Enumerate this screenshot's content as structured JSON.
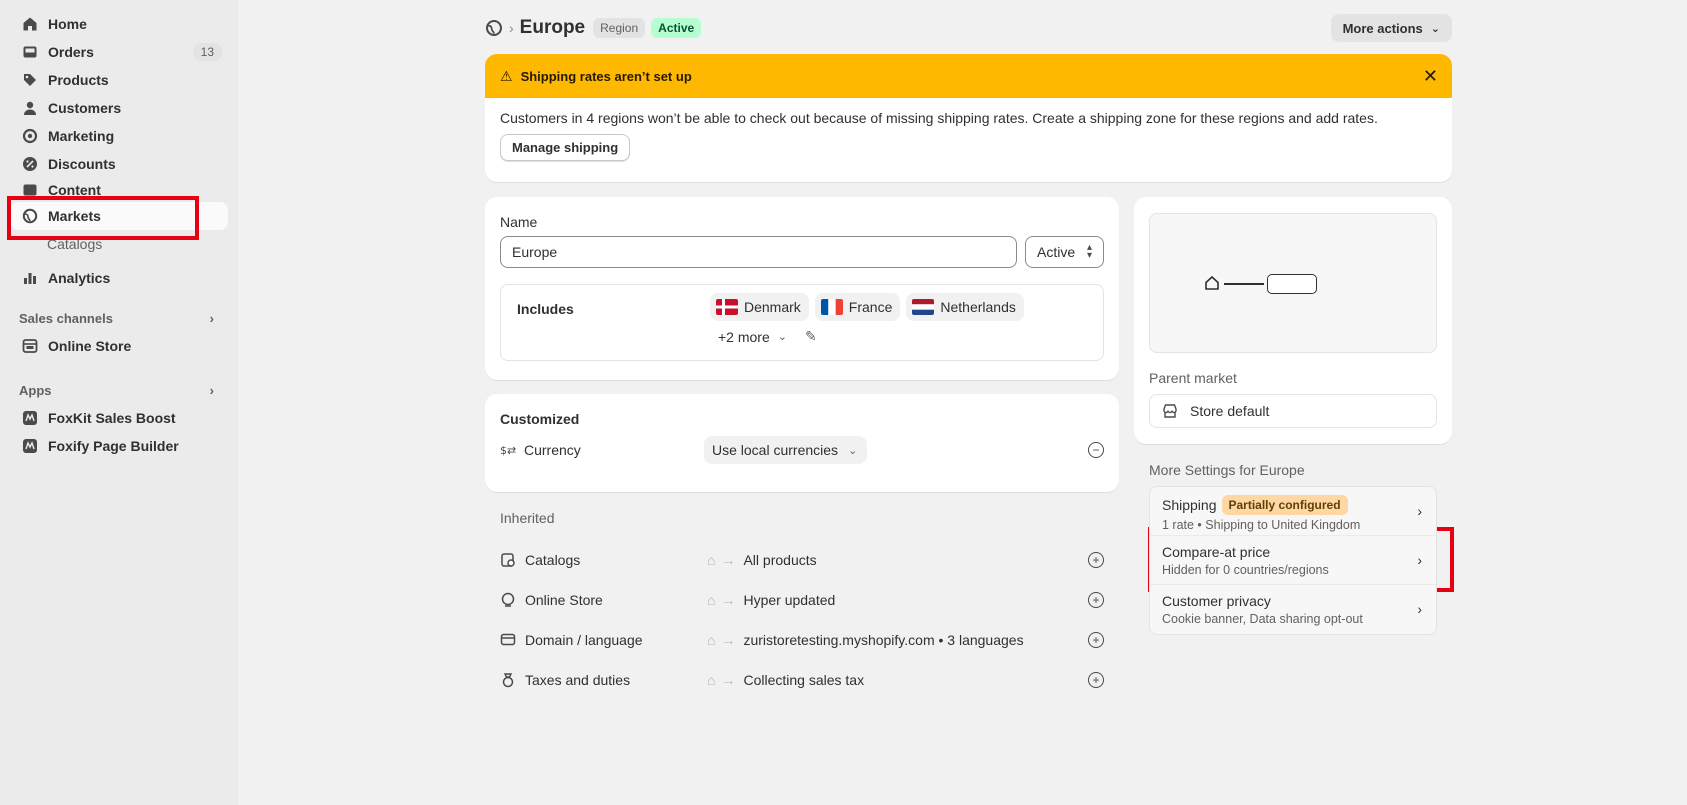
{
  "sidebar": {
    "items": [
      {
        "label": "Home"
      },
      {
        "label": "Orders",
        "badge": "13"
      },
      {
        "label": "Products"
      },
      {
        "label": "Customers"
      },
      {
        "label": "Marketing"
      },
      {
        "label": "Discounts"
      },
      {
        "label": "Content"
      },
      {
        "label": "Markets"
      },
      {
        "label": "Catalogs"
      },
      {
        "label": "Analytics"
      }
    ],
    "sales_channels": {
      "title": "Sales channels",
      "items": [
        {
          "label": "Online Store"
        }
      ]
    },
    "apps": {
      "title": "Apps",
      "items": [
        {
          "label": "FoxKit Sales Boost"
        },
        {
          "label": "Foxify Page Builder"
        }
      ]
    }
  },
  "header": {
    "separator": "›",
    "title": "Europe",
    "tag_region": "Region",
    "tag_status": "Active",
    "more_actions": "More actions"
  },
  "banner": {
    "title": "Shipping rates aren’t set up",
    "message": "Customers in 4 regions won’t be able to check out because of missing shipping rates. Create a shipping zone for these regions and add rates.",
    "button": "Manage shipping"
  },
  "name_card": {
    "label": "Name",
    "value": "Europe",
    "status": "Active",
    "includes_label": "Includes",
    "countries": [
      "Denmark",
      "France",
      "Netherlands"
    ],
    "more": "+2 more"
  },
  "customized": {
    "title": "Customized",
    "currency_label": "Currency",
    "currency_value": "Use local currencies"
  },
  "inherited": {
    "title": "Inherited",
    "rows": [
      {
        "name": "Catalogs",
        "value": "All products"
      },
      {
        "name": "Online Store",
        "value": "Hyper updated"
      },
      {
        "name": "Domain / language",
        "value": "zuristoretesting.myshopify.com • 3 languages"
      },
      {
        "name": "Taxes and duties",
        "value": "Collecting sales tax"
      }
    ]
  },
  "parent_market": {
    "label": "Parent market",
    "value": "Store default"
  },
  "more_settings": {
    "title": "More Settings for Europe",
    "items": [
      {
        "title": "Shipping",
        "badge": "Partially configured",
        "subtitle": "1 rate • Shipping to United Kingdom"
      },
      {
        "title": "Compare-at price",
        "subtitle": "Hidden for 0 countries/regions"
      },
      {
        "title": "Customer privacy",
        "subtitle": "Cookie banner, Data sharing opt-out"
      }
    ]
  },
  "colors": {
    "banner_warning": "#ffb800",
    "active_green": "#b4fed2",
    "partial_orange": "#ffd6a4",
    "highlight_red": "#e60012"
  }
}
